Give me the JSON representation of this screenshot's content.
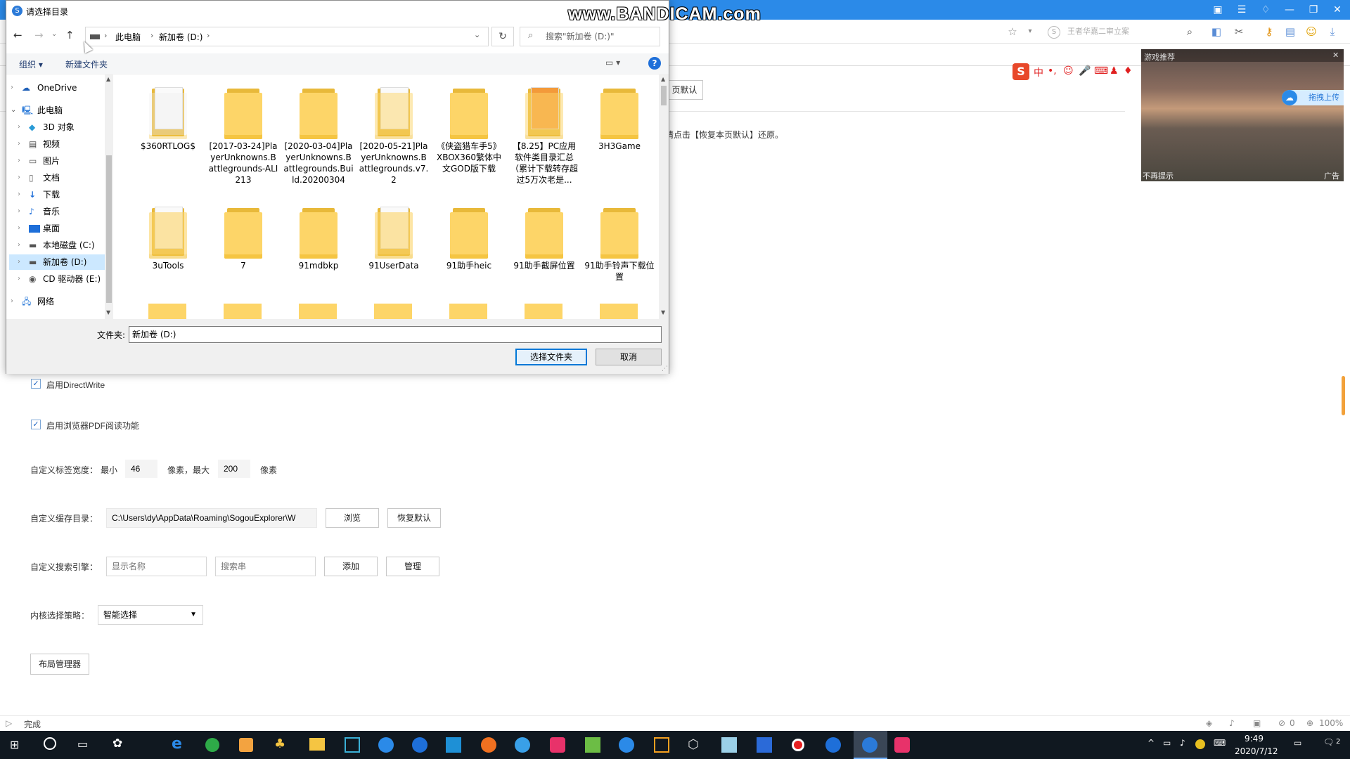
{
  "watermark": "www.BANDICAM.com",
  "browser": {
    "search_placeholder": "王者华嘉二审立案",
    "partial_button": "页默认",
    "restore_hint": "请点击【恢复本页默认】还原。",
    "video": {
      "header": "游戏推荐",
      "upload": "拖拽上传",
      "no_tip": "不再提示",
      "ad": "广告"
    }
  },
  "settings": {
    "directwrite": "启用DirectWrite",
    "pdf": "启用浏览器PDF阅读功能",
    "tabwidth_label": "自定义标签宽度：",
    "min_label": "最小",
    "min_value": "46",
    "px_max_label": "像素，最大",
    "max_value": "200",
    "px_label": "像素",
    "cache_label": "自定义缓存目录：",
    "cache_path": "C:\\Users\\dy\\AppData\\Roaming\\SogouExplorer\\W",
    "browse": "浏览",
    "restore": "恢复默认",
    "engine_label": "自定义搜索引擎：",
    "engine_name_placeholder": "显示名称",
    "engine_url_placeholder": "搜索串",
    "add": "添加",
    "manage": "管理",
    "kernel_label": "内核选择策略：",
    "kernel_value": "智能选择",
    "layout_manager": "布局管理器"
  },
  "status": {
    "text": "完成",
    "zoom": "100%",
    "counter": "0"
  },
  "dialog": {
    "title": "请选择目录",
    "breadcrumb": [
      "此电脑",
      "新加卷 (D:)"
    ],
    "search_placeholder": "搜索\"新加卷 (D:)\"",
    "organize": "组织",
    "new_folder": "新建文件夹",
    "nav": [
      {
        "label": "OneDrive",
        "icon": "cloud-icon"
      },
      {
        "label": "此电脑",
        "icon": "pc-icon"
      },
      {
        "label": "3D 对象",
        "icon": "cube-icon"
      },
      {
        "label": "视频",
        "icon": "video-icon"
      },
      {
        "label": "图片",
        "icon": "picture-icon"
      },
      {
        "label": "文档",
        "icon": "document-icon"
      },
      {
        "label": "下载",
        "icon": "download-icon"
      },
      {
        "label": "音乐",
        "icon": "music-icon"
      },
      {
        "label": "桌面",
        "icon": "desktop-icon"
      },
      {
        "label": "本地磁盘 (C:)",
        "icon": "drive-icon"
      },
      {
        "label": "新加卷 (D:)",
        "icon": "drive-icon"
      },
      {
        "label": "CD 驱动器 (E:)",
        "icon": "cd-icon"
      },
      {
        "label": "网络",
        "icon": "network-icon"
      }
    ],
    "folders": [
      "$360RTLOG$",
      "[2017-03-24]PlayerUnknowns.Battlegrounds-ALI213",
      "[2020-03-04]PlayerUnknowns.Battlegrounds.Build.20200304",
      "[2020-05-21]PlayerUnknowns.Battlegrounds.v7.2",
      "《侠盗猎车手5》XBOX360繁体中文GOD版下载",
      "【8.25】PC应用软件类目录汇总（累计下载转存超过5万次老是...",
      "3H3Game",
      "3uTools",
      "7",
      "91mdbkp",
      "91UserData",
      "91助手heic",
      "91助手截屏位置",
      "91助手铃声下载位置"
    ],
    "folder_label": "文件夹:",
    "folder_value": "新加卷 (D:)",
    "select": "选择文件夹",
    "cancel": "取消"
  },
  "taskbar": {
    "time": "9:49",
    "date": "2020/7/12",
    "notifications": "2"
  }
}
